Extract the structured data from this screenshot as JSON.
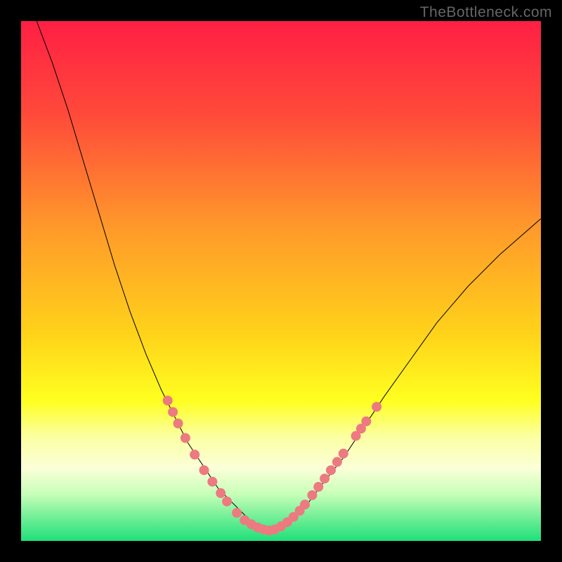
{
  "watermark": "TheBottleneck.com",
  "chart_data": {
    "type": "line",
    "title": "",
    "xlabel": "",
    "ylabel": "",
    "xlim": [
      0,
      100
    ],
    "ylim": [
      0,
      100
    ],
    "background_gradient": {
      "stops": [
        {
          "offset": 0.0,
          "color": "#ff1f44"
        },
        {
          "offset": 0.18,
          "color": "#ff4a3a"
        },
        {
          "offset": 0.4,
          "color": "#ff9a2a"
        },
        {
          "offset": 0.6,
          "color": "#ffd21a"
        },
        {
          "offset": 0.73,
          "color": "#ffff20"
        },
        {
          "offset": 0.8,
          "color": "#fbffa2"
        },
        {
          "offset": 0.86,
          "color": "#fbffd8"
        },
        {
          "offset": 0.91,
          "color": "#c7ffb8"
        },
        {
          "offset": 0.95,
          "color": "#7af09a"
        },
        {
          "offset": 1.0,
          "color": "#1fe07a"
        }
      ]
    },
    "series": [
      {
        "name": "bottleneck-curve",
        "stroke": "#000000",
        "stroke_width": 1,
        "x": [
          3,
          6,
          9,
          12,
          15,
          18,
          21,
          24,
          27,
          30,
          32,
          34,
          36,
          38,
          40,
          42,
          44,
          46,
          48,
          50,
          52,
          55,
          58,
          62,
          66,
          70,
          75,
          80,
          86,
          92,
          100
        ],
        "y": [
          100,
          92,
          83,
          73,
          63,
          53,
          44,
          36,
          29,
          23,
          19,
          16,
          13,
          10,
          8,
          6,
          4,
          3,
          2,
          3,
          4,
          7,
          11,
          16,
          22,
          28,
          35,
          42,
          49,
          55,
          62
        ]
      }
    ],
    "markers": {
      "name": "highlight-dots",
      "color": "#ec7a80",
      "radius": 7,
      "points": [
        {
          "x": 28.2,
          "y": 27.0
        },
        {
          "x": 29.2,
          "y": 24.8
        },
        {
          "x": 30.2,
          "y": 22.6
        },
        {
          "x": 31.6,
          "y": 19.8
        },
        {
          "x": 33.4,
          "y": 16.6
        },
        {
          "x": 35.2,
          "y": 13.6
        },
        {
          "x": 36.8,
          "y": 11.4
        },
        {
          "x": 38.4,
          "y": 9.2
        },
        {
          "x": 39.6,
          "y": 7.6
        },
        {
          "x": 41.5,
          "y": 5.4
        },
        {
          "x": 43.0,
          "y": 4.0
        },
        {
          "x": 44.3,
          "y": 3.2
        },
        {
          "x": 45.5,
          "y": 2.6
        },
        {
          "x": 46.6,
          "y": 2.2
        },
        {
          "x": 47.7,
          "y": 2.0
        },
        {
          "x": 48.8,
          "y": 2.2
        },
        {
          "x": 50.0,
          "y": 2.8
        },
        {
          "x": 51.2,
          "y": 3.6
        },
        {
          "x": 52.4,
          "y": 4.6
        },
        {
          "x": 53.6,
          "y": 5.8
        },
        {
          "x": 54.6,
          "y": 7.0
        },
        {
          "x": 56.0,
          "y": 8.8
        },
        {
          "x": 57.2,
          "y": 10.4
        },
        {
          "x": 58.4,
          "y": 12.0
        },
        {
          "x": 59.6,
          "y": 13.6
        },
        {
          "x": 60.8,
          "y": 15.2
        },
        {
          "x": 62.0,
          "y": 16.8
        },
        {
          "x": 64.4,
          "y": 20.2
        },
        {
          "x": 65.4,
          "y": 21.6
        },
        {
          "x": 66.4,
          "y": 23.0
        },
        {
          "x": 68.4,
          "y": 25.8
        }
      ]
    }
  }
}
